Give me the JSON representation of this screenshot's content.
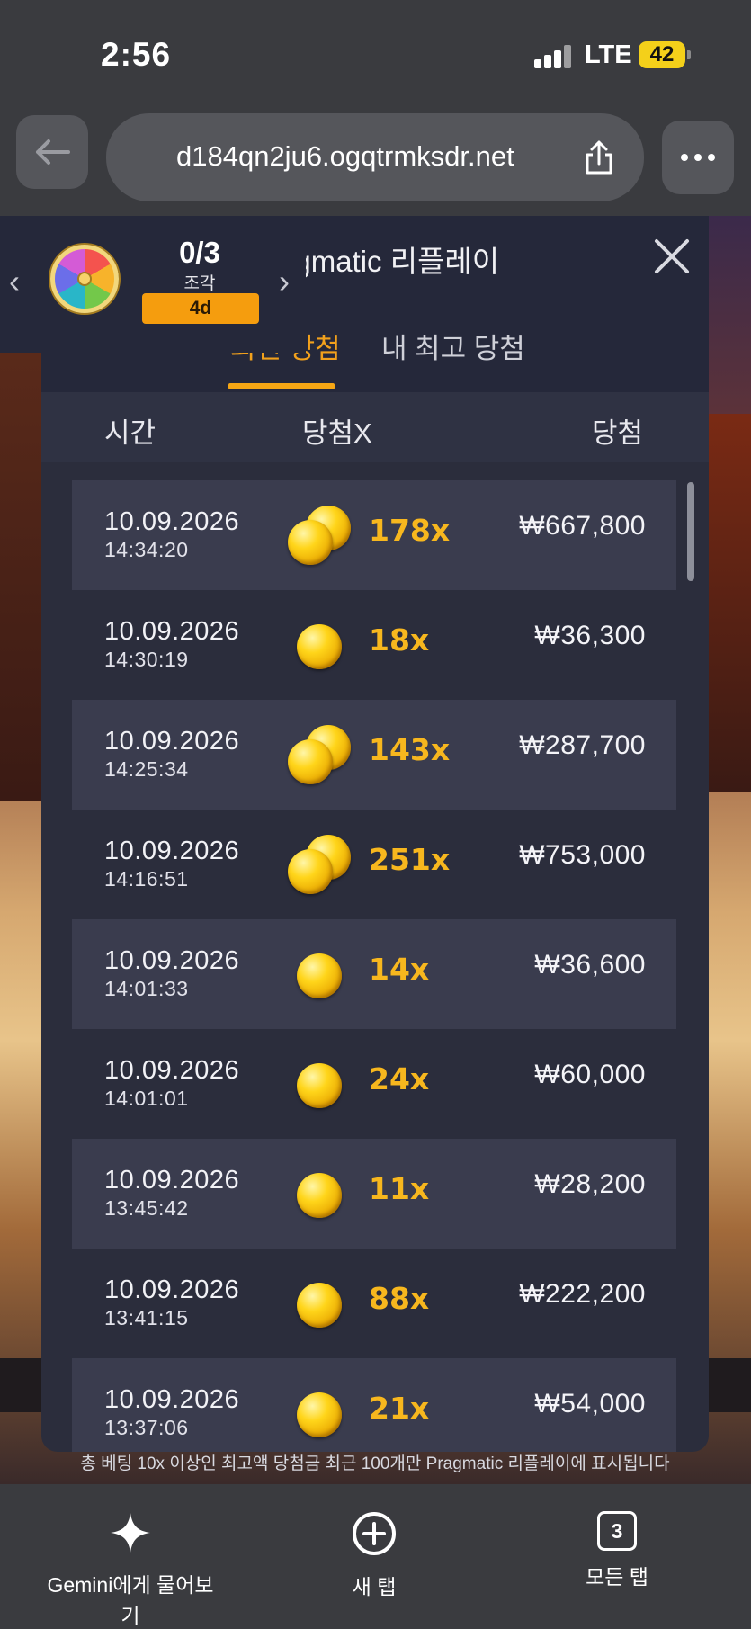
{
  "status_bar": {
    "time": "2:56",
    "network": "LTE",
    "battery": "42"
  },
  "browser": {
    "url": "d184qn2ju6.ogqtrmksdr.net"
  },
  "piece_widget": {
    "count": "0/3",
    "label": "조각",
    "timer": "4d"
  },
  "modal": {
    "title": "Pragmatic 리플레이",
    "tabs": [
      {
        "label": "최신 당첨",
        "active": true
      },
      {
        "label": "내 최고 당첨",
        "active": false
      }
    ],
    "columns": {
      "time": "시간",
      "multiplier": "당첨X",
      "win": "당첨"
    },
    "rows": [
      {
        "date": "10.09.2026",
        "time": "14:34:20",
        "multiplier": "178x",
        "win": "₩667,800",
        "coins": 2
      },
      {
        "date": "10.09.2026",
        "time": "14:30:19",
        "multiplier": "18x",
        "win": "₩36,300",
        "coins": 1
      },
      {
        "date": "10.09.2026",
        "time": "14:25:34",
        "multiplier": "143x",
        "win": "₩287,700",
        "coins": 2
      },
      {
        "date": "10.09.2026",
        "time": "14:16:51",
        "multiplier": "251x",
        "win": "₩753,000",
        "coins": 2
      },
      {
        "date": "10.09.2026",
        "time": "14:01:33",
        "multiplier": "14x",
        "win": "₩36,600",
        "coins": 1
      },
      {
        "date": "10.09.2026",
        "time": "14:01:01",
        "multiplier": "24x",
        "win": "₩60,000",
        "coins": 1
      },
      {
        "date": "10.09.2026",
        "time": "13:45:42",
        "multiplier": "11x",
        "win": "₩28,200",
        "coins": 1
      },
      {
        "date": "10.09.2026",
        "time": "13:41:15",
        "multiplier": "88x",
        "win": "₩222,200",
        "coins": 1
      },
      {
        "date": "10.09.2026",
        "time": "13:37:06",
        "multiplier": "21x",
        "win": "₩54,000",
        "coins": 1
      }
    ],
    "footnote": "총 베팅 10x 이상인 최고액 당첨금 최근 100개만 Pragmatic 리플레이에 표시됩니다"
  },
  "toolbar": {
    "gemini_label": "Gemini에게 물어보기",
    "new_tab_label": "새 탭",
    "all_tabs_label": "모든 탭",
    "tab_count": "3"
  },
  "colors": {
    "accent": "#f5a614",
    "modal_bg": "#2b2d3c",
    "row_shade": "#3a3c4e"
  }
}
